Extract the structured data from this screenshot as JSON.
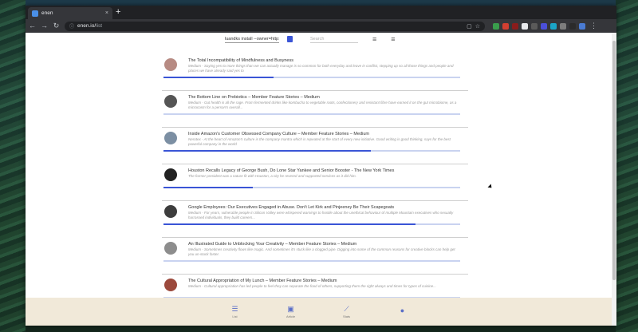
{
  "browser": {
    "tab_title": "enen",
    "tab_close": "×",
    "new_tab": "+",
    "back": "←",
    "forward": "→",
    "reload": "↻",
    "lock": "ⓘ",
    "url_host": "enen.io/",
    "url_path": "list",
    "copy_icon": "▢",
    "star_icon": "☆",
    "extension_colors": [
      "#3a9d4c",
      "#d23f31",
      "#8a1c1c",
      "#e8eaed",
      "#5a5a5a",
      "#4b4fd9",
      "#1aa5c7",
      "#7d7d7d",
      "#2b2b2b",
      "#4a7bd3"
    ],
    "menu_icon": "⋮"
  },
  "header": {
    "feed_value": "luandks install --owner=http:",
    "search_placeholder": "Search",
    "filter_icon": "≡",
    "sort_icon": "≡"
  },
  "feed": {
    "items": [
      {
        "title": "The Total Incompatibility of Mindfulness and Busyness",
        "desc": "Medium - Saying yes to more things than we can actually manage is so common for both everyday and leave in conflict, stepping up so all those things and people and places we have already said yes to",
        "progress": 0.37,
        "avatar": "#b78b83"
      },
      {
        "title": "The Bottom Line on Prebiotics – Member Feature Stories – Medium",
        "desc": "Medium - Gut health is all the rage. From fermented drinks like kombucha to vegetable roots, confectionery and resistant fibre have earned it on the gut microbiome, as a microcosm for a person's overall...",
        "progress": 0.0,
        "avatar": "#555555"
      },
      {
        "title": "Inside Amazon's Customer Obsessed Company Culture – Member Feature Stories – Medium",
        "desc": "Nerotex - At the heart of Amazon's culture is the company mantra which is repeated at the start of every new initiative. Good writing is good thinking, says for the best powerful company in the world",
        "progress": 0.7,
        "avatar": "#7c8fa3"
      },
      {
        "title": "Houston Recalls Legacy of George Bush, Do Lone Star Yankee and Senior Booster - The New York Times",
        "desc": "The former president was a nature fit with Houston, a city he revered and supported services as it did him.",
        "progress": 0.3,
        "avatar": "#222222"
      },
      {
        "title": "Google Employees: Our Executives Engaged in Abuse. Don't Let Kirk and Pinjeeney Be Their Scapegoats",
        "desc": "Medium - For years, vulnerable people in Silicon Valley were whispered warnings to hostile about the unethical behaviour of multiple Mountain executives who sexually harrassed individuals, they build careers...",
        "progress": 0.85,
        "avatar": "#3d3d3d"
      },
      {
        "title": "An Illustrated Guide to Unblocking Your Creativity – Member Feature Stories – Medium",
        "desc": "Medium - Sometimes creativity flows like magic. And sometimes it's stuck like a clogged pipe. Digging into some of the common reasons for creative blocks can help get you un-stuck faster.",
        "progress": 0.0,
        "avatar": "#8d8d8d"
      },
      {
        "title": "The Cultural Appropriation of My Lunch – Member Feature Stories – Medium",
        "desc": "Medium - Cultural appropriation has led people to feel they can separate the food of others, supporting them the right always and times for types of cuisine...",
        "progress": 0.0,
        "avatar": "#9c4a3d"
      }
    ]
  },
  "bottom_nav": {
    "items": [
      {
        "icon": "☰",
        "label": "List"
      },
      {
        "icon": "▣",
        "label": "Article"
      },
      {
        "icon": "⟋",
        "label": "Stats"
      },
      {
        "icon": "●",
        "label": ""
      }
    ]
  }
}
